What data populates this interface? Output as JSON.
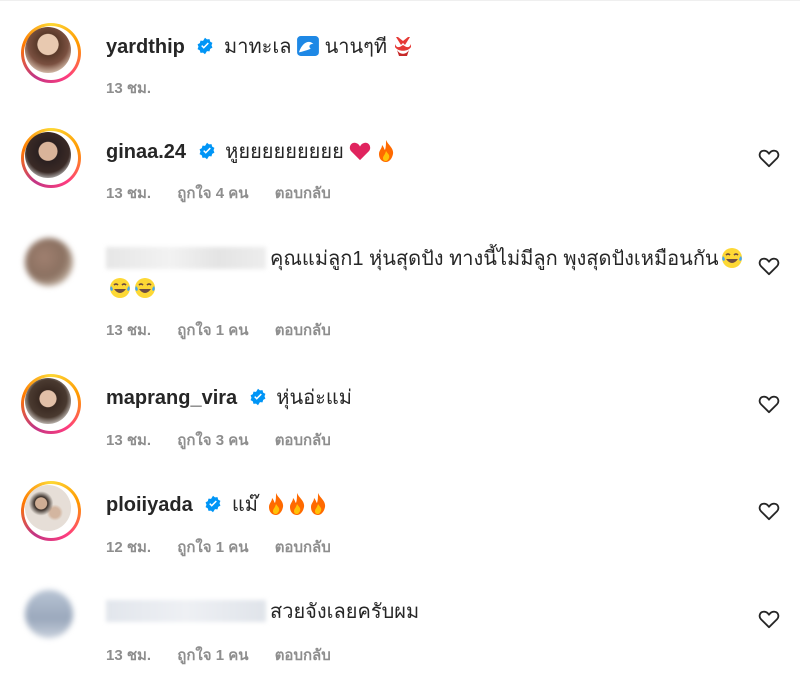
{
  "comments": [
    {
      "username": "yardthip",
      "verified": true,
      "text": "มาทะเล",
      "text_after": "นานๆที",
      "emojis": [
        "wave-emoji",
        "bikini-emoji"
      ],
      "time": "13 ชม.",
      "likes": "",
      "reply": "",
      "has_heart": false
    },
    {
      "username": "ginaa.24",
      "verified": true,
      "text": "หูยยยยยยยยย",
      "emojis": [
        "heart-emoji",
        "fire-emoji"
      ],
      "time": "13 ชม.",
      "likes": "ถูกใจ 4 คน",
      "reply": "ตอบกลับ",
      "has_heart": true
    },
    {
      "username": "",
      "verified": false,
      "text": "คุณแม่ลูก1 หุ่นสุดปัง ทางนี้ไม่มีลูก พุงสุดปังเหมือนกัน",
      "emojis": [
        "tears-of-joy-emoji",
        "tears-of-joy-emoji",
        "tears-of-joy-emoji"
      ],
      "time": "13 ชม.",
      "likes": "ถูกใจ 1 คน",
      "reply": "ตอบกลับ",
      "has_heart": true
    },
    {
      "username": "maprang_vira",
      "verified": true,
      "text": "หุ่นอ่ะแม่",
      "emojis": [],
      "time": "13 ชม.",
      "likes": "ถูกใจ 3 คน",
      "reply": "ตอบกลับ",
      "has_heart": true
    },
    {
      "username": "ploiiyada",
      "verified": true,
      "text": "แม๊",
      "emojis": [
        "fire-emoji",
        "fire-emoji",
        "fire-emoji"
      ],
      "time": "12 ชม.",
      "likes": "ถูกใจ 1 คน",
      "reply": "ตอบกลับ",
      "has_heart": true
    },
    {
      "username": "",
      "verified": false,
      "text": "สวยจังเลยครับผม",
      "emojis": [],
      "time": "13 ชม.",
      "likes": "ถูกใจ 1 คน",
      "reply": "ตอบกลับ",
      "has_heart": true
    }
  ],
  "colors": {
    "verified": "#0095f6",
    "meta": "#8e8e8e",
    "text": "#262626",
    "fire": "#ff6a00",
    "heart": "#e0245e"
  }
}
